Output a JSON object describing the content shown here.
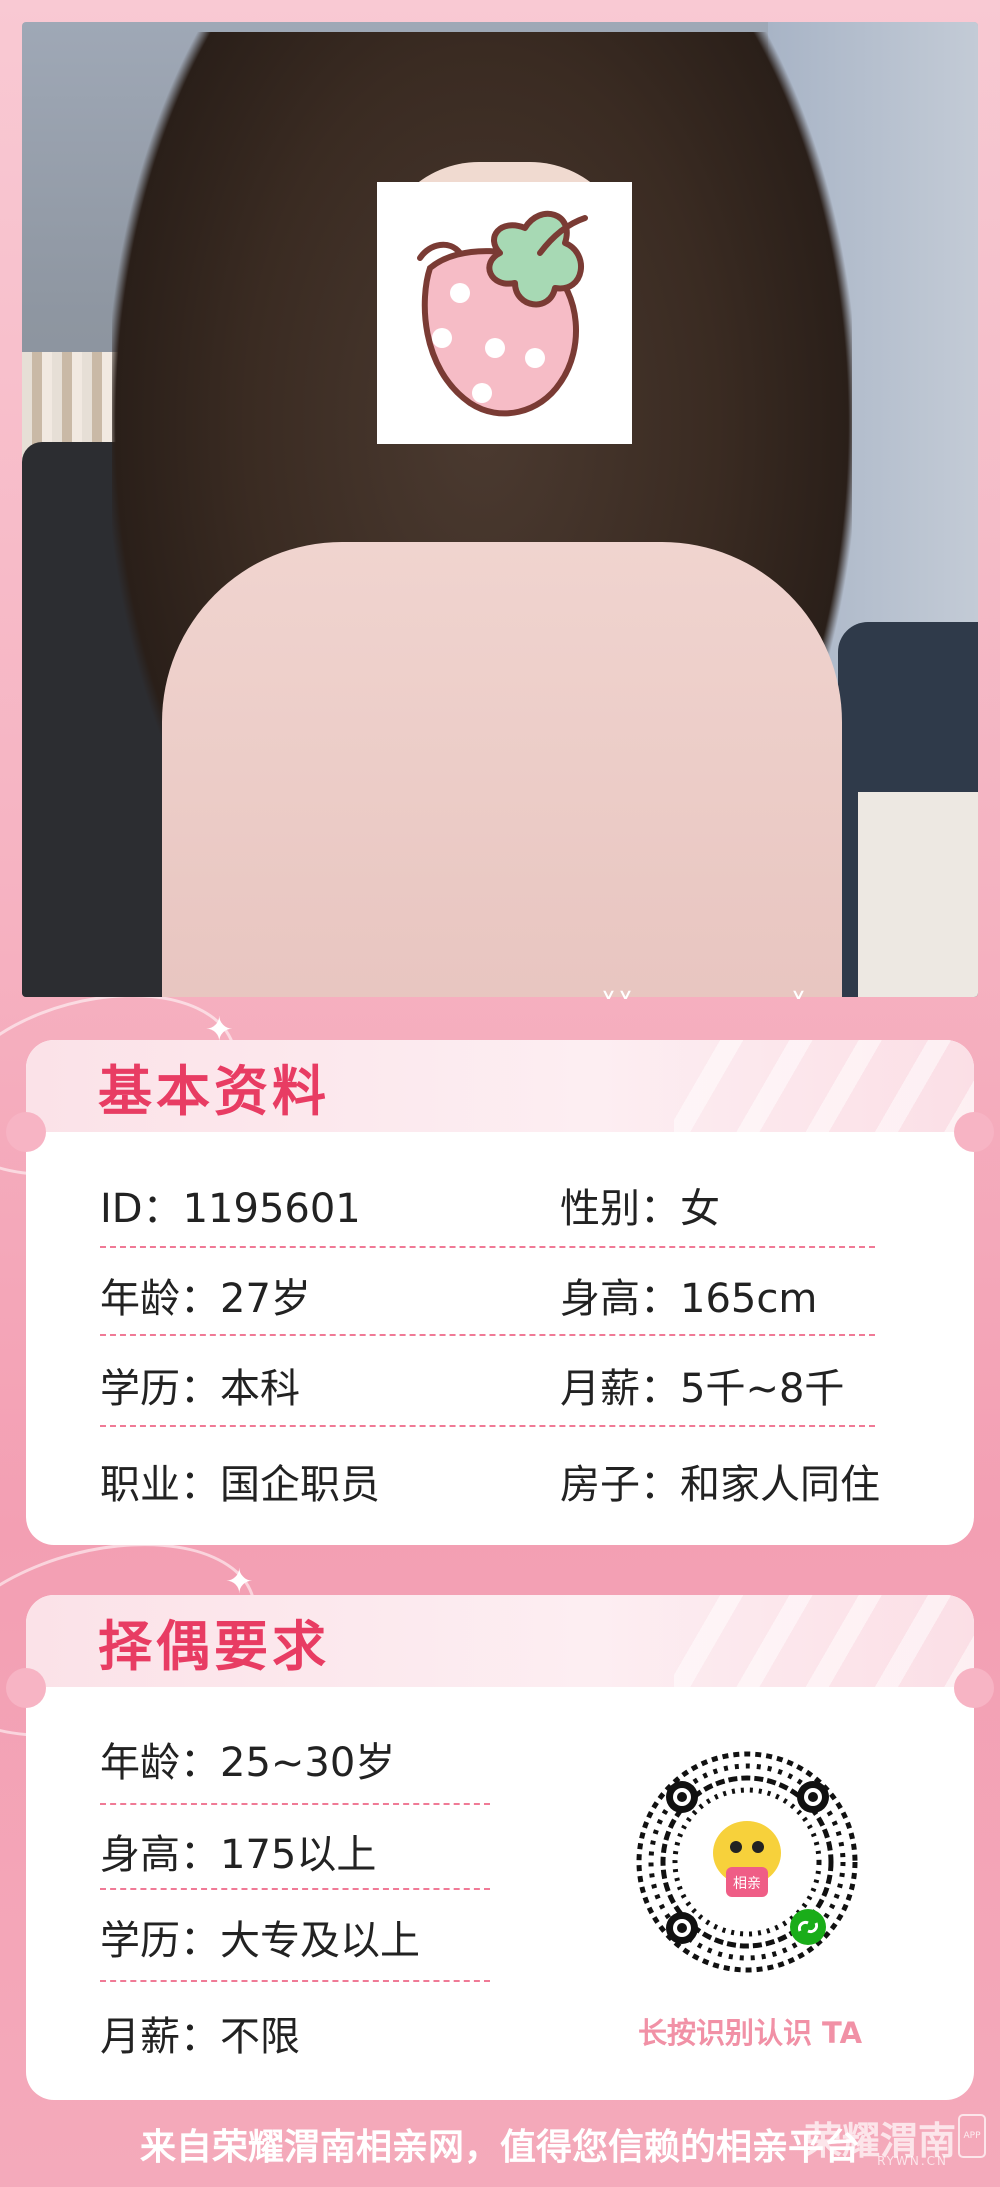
{
  "photo": {
    "sticker_icon": "strawberry-icon"
  },
  "basic_info": {
    "title": "基本资料",
    "rows": [
      {
        "left": "ID：1195601",
        "right": "性别：女"
      },
      {
        "left": "年龄：27岁",
        "right": "身高：165cm"
      },
      {
        "left": "学历：本科",
        "right": "月薪：5千~8千"
      },
      {
        "left": "职业：国企职员",
        "right": "房子：和家人同住"
      }
    ]
  },
  "requirements": {
    "title": "择偶要求",
    "rows": [
      "年龄：25~30岁",
      "身高：175以上",
      "学历：大专及以上",
      "月薪：不限"
    ],
    "qr_caption": "长按识别认识 TA",
    "qr_badge": "相亲"
  },
  "footer": {
    "text": "来自荣耀渭南相亲网，值得您信赖的相亲平台",
    "watermark": "荣耀渭南",
    "watermark_sub": "RYWN.CN",
    "app_badge": "APP"
  },
  "colors": {
    "accent": "#e83c63",
    "background": "#f6b3c2",
    "dash": "#f07a96",
    "caption": "#f191a6"
  }
}
